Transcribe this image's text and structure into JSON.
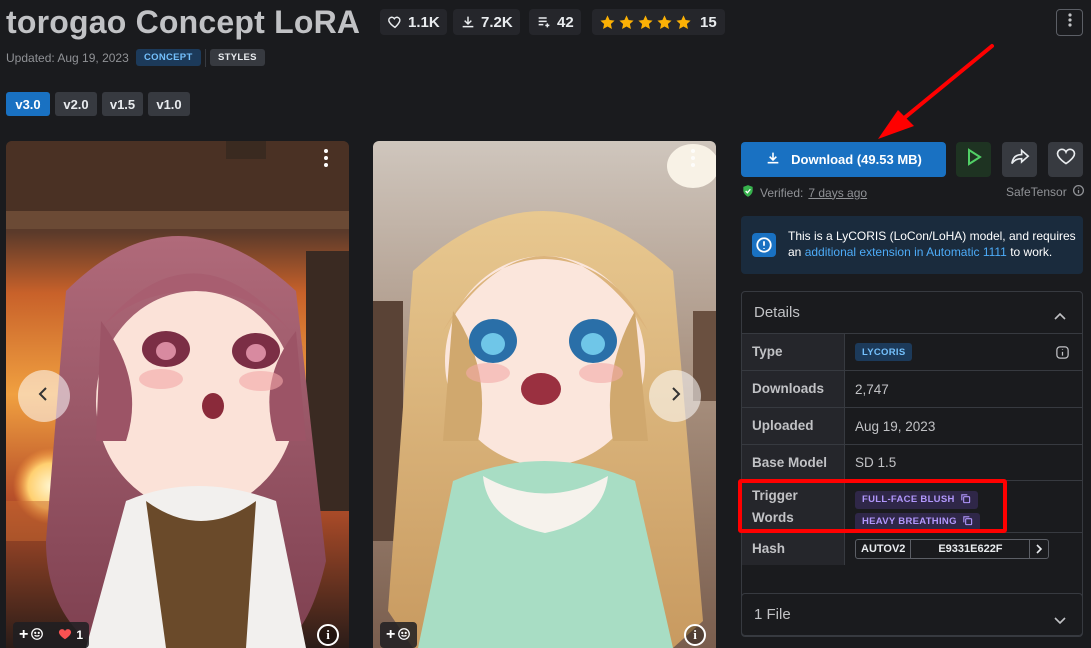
{
  "header": {
    "title": "torogao Concept LoRA",
    "stats": {
      "likes": "1.1K",
      "downloads": "7.2K",
      "collections": "42",
      "rating_stars": 5,
      "rating_count": "15"
    },
    "updated": "Updated: Aug 19, 2023",
    "badges": [
      "CONCEPT",
      "STYLES"
    ],
    "versions": [
      {
        "label": "v3.0",
        "active": true
      },
      {
        "label": "v2.0",
        "active": false
      },
      {
        "label": "v1.5",
        "active": false
      },
      {
        "label": "v1.0",
        "active": false
      }
    ]
  },
  "gallery": {
    "card1": {
      "reaction_add": "+",
      "likes_count": "1"
    },
    "card2": {
      "reaction_add": "+"
    }
  },
  "sidebar": {
    "download_label": "Download (49.53 MB)",
    "verified_prefix": "Verified:",
    "verified_when": "7 days ago",
    "safetensor": "SafeTensor",
    "alert": {
      "text_before": "This is a LyCORIS (LoCon/LoHA) model, and requires an",
      "link": "additional extension in Automatic 1111",
      "text_after": "to work."
    },
    "details": {
      "heading": "Details",
      "type_label": "Type",
      "type_value": "LYCORIS",
      "downloads_label": "Downloads",
      "downloads_value": "2,747",
      "uploaded_label": "Uploaded",
      "uploaded_value": "Aug 19, 2023",
      "base_label": "Base Model",
      "base_value": "SD 1.5",
      "trigger_label_1": "Trigger",
      "trigger_label_2": "Words",
      "trigger_words": [
        "FULL-FACE BLUSH",
        "HEAVY BREATHING"
      ],
      "hash_label": "Hash",
      "hash_type": "AUTOV2",
      "hash_value": "E9331E622F"
    },
    "files_label": "1 File"
  },
  "colors": {
    "accent": "#1971c2",
    "star": "#fab005",
    "annotation_red": "#ff0000",
    "verified_green": "#37b24d",
    "trigger_purple": "#b197fc"
  }
}
